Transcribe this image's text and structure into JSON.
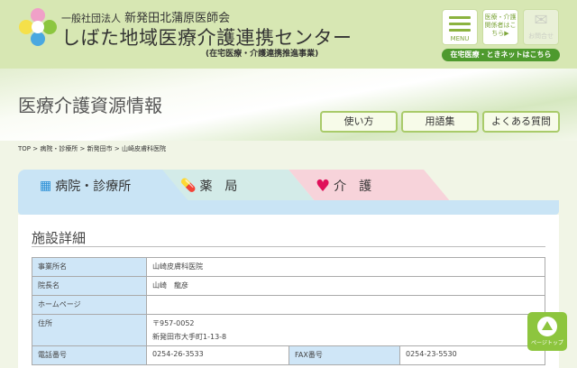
{
  "header": {
    "org": "一般社団法人",
    "org_name": "新発田北蒲原医師会",
    "center": "しばた地域医療介護連携センター",
    "sub": "(在宅医療・介護連携推進事業)",
    "menu_label": "MENU",
    "relations_label": "医療・介護関係者はこちら▶",
    "contact_label": "お問合せ",
    "banner": "在宅医療・ときネットはこちら"
  },
  "page": {
    "title": "医療介護資源情報",
    "buttons": [
      "使い方",
      "用語集",
      "よくある質問"
    ]
  },
  "breadcrumb": "TOP > 病院・診療所 > 新発田市 > 山崎皮膚科医院",
  "tabs": [
    "病院・診療所",
    "薬　局",
    "介　護"
  ],
  "section": "施設詳細",
  "table": {
    "rows": [
      [
        "事業所名",
        "山崎皮膚科医院"
      ],
      [
        "院長名",
        "山崎　龍彦"
      ],
      [
        "ホームページ",
        ""
      ]
    ],
    "address_label": "住所",
    "postal": "〒957-0052",
    "address": "新発田市大手町1-13-8",
    "tel_label": "電話番号",
    "tel": "0254-26-3533",
    "fax_label": "FAX番号",
    "fax": "0254-23-5530"
  },
  "page_top": "ページトップ"
}
